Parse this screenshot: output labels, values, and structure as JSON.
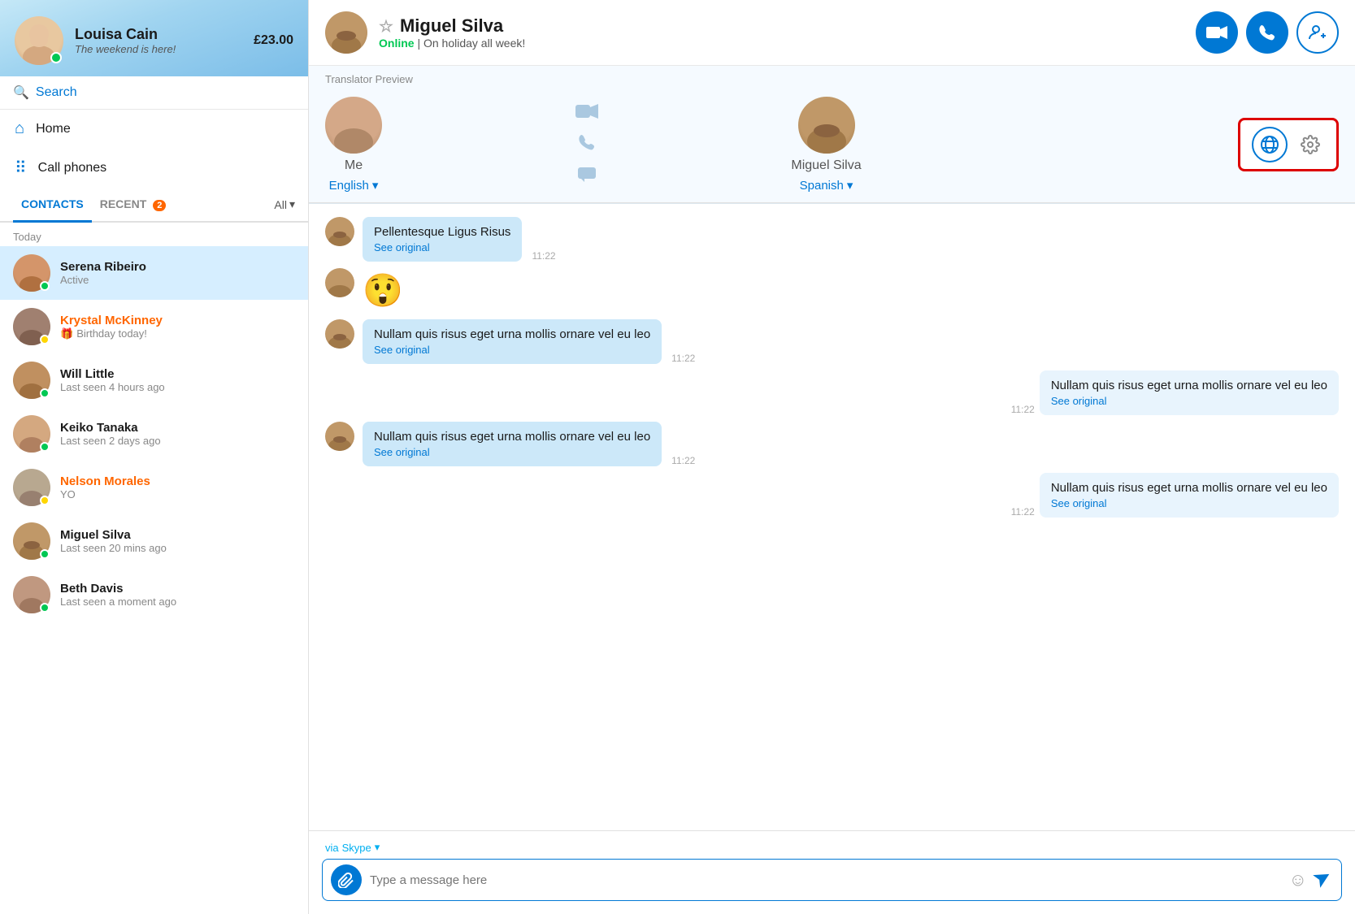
{
  "sidebar": {
    "user": {
      "name": "Louisa Cain",
      "status": "The weekend is here!",
      "credit": "£23.00",
      "online": true
    },
    "search": {
      "placeholder": "Search",
      "label": "Search"
    },
    "nav": [
      {
        "id": "home",
        "label": "Home",
        "icon": "⌂"
      },
      {
        "id": "call-phones",
        "label": "Call phones",
        "icon": "⠿"
      }
    ],
    "tabs": [
      {
        "id": "contacts",
        "label": "CONTACTS",
        "active": true
      },
      {
        "id": "recent",
        "label": "RECENT",
        "badge": "2",
        "active": false
      }
    ],
    "tab_all": "All",
    "section_today": "Today",
    "contacts": [
      {
        "id": "serena",
        "name": "Serena Ribeiro",
        "sub": "Active",
        "status": "online",
        "selected": true,
        "highlight": false
      },
      {
        "id": "krystal",
        "name": "Krystal McKinney",
        "sub": "Birthday today!",
        "sub_icon": "🎁",
        "status": "away",
        "selected": false,
        "highlight": true
      },
      {
        "id": "will",
        "name": "Will Little",
        "sub": "Last seen 4 hours ago",
        "status": "online",
        "selected": false,
        "highlight": false
      },
      {
        "id": "keiko",
        "name": "Keiko Tanaka",
        "sub": "Last seen 2 days ago",
        "status": "online",
        "selected": false,
        "highlight": false
      },
      {
        "id": "nelson",
        "name": "Nelson Morales",
        "sub": "YO",
        "status": "away",
        "selected": false,
        "highlight": true
      },
      {
        "id": "miguel",
        "name": "Miguel Silva",
        "sub": "Last seen 20 mins ago",
        "status": "online",
        "selected": false,
        "highlight": false
      },
      {
        "id": "beth",
        "name": "Beth Davis",
        "sub": "Last seen a moment ago",
        "status": "online",
        "selected": false,
        "highlight": false
      }
    ]
  },
  "chat": {
    "contact": {
      "name": "Miguel Silva",
      "status_label": "Online",
      "status_note": "On holiday all week!",
      "online": true
    },
    "actions": {
      "video_call": "📹",
      "voice_call": "📞",
      "add_contact": "➕"
    },
    "translator": {
      "title": "Translator Preview",
      "me_label": "Me",
      "me_lang": "English",
      "other_label": "Miguel Silva",
      "other_lang": "Spanish"
    },
    "messages": [
      {
        "id": 1,
        "sender": "miguel",
        "side": "left",
        "text": "Pellentesque Ligus Risus",
        "see_original": "See original",
        "time": "11:22"
      },
      {
        "id": 2,
        "sender": "miguel",
        "side": "left",
        "emoji": "😲",
        "time": ""
      },
      {
        "id": 3,
        "sender": "miguel",
        "side": "left",
        "text": "Nullam quis risus eget urna mollis ornare vel eu leo",
        "see_original": "See original",
        "time": "11:22"
      },
      {
        "id": 4,
        "sender": "me",
        "side": "right",
        "text": "Nullam quis risus eget urna mollis ornare vel eu leo",
        "see_original": "See original",
        "time": "11:22"
      },
      {
        "id": 5,
        "sender": "miguel",
        "side": "left",
        "text": "Nullam quis risus eget urna mollis ornare vel eu leo",
        "see_original": "See original",
        "time": "11:22"
      },
      {
        "id": 6,
        "sender": "me",
        "side": "right",
        "text": "Nullam quis risus eget urna mollis ornare vel eu leo",
        "see_original": "See original",
        "time": "11:22"
      }
    ],
    "input": {
      "placeholder": "Type a message here",
      "via_label": "via",
      "via_service": "Skype"
    }
  }
}
